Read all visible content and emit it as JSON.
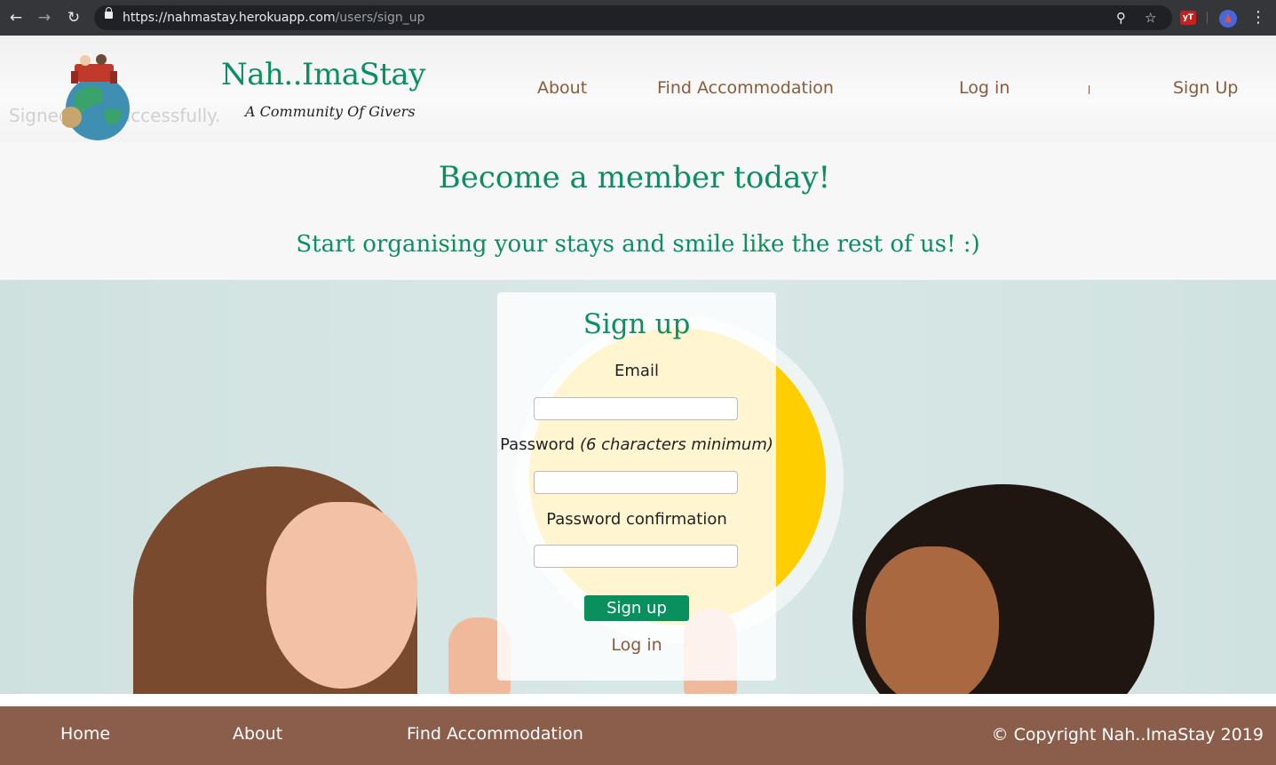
{
  "browser": {
    "url_host": "https://nahmastay.herokuapp.com",
    "url_path": "/users/sign_up",
    "icons": {
      "back": "back-arrow-icon",
      "forward": "forward-arrow-icon",
      "reload": "reload-icon",
      "zoom": "zoom-icon",
      "bookmark": "star-icon",
      "menu": "more-vertical-icon"
    },
    "extension_label": "yT"
  },
  "header": {
    "flash_message": "Signed out successfully.",
    "brand": "Nah..ImaStay",
    "tagline": "A Community Of Givers",
    "nav": {
      "about": "About",
      "find": "Find Accommodation",
      "login": "Log in",
      "signup": "Sign Up"
    }
  },
  "intro": {
    "title": "Become a member today!",
    "subtitle": "Start organising your stays and smile like the rest of us! :)"
  },
  "form": {
    "title": "Sign up",
    "email_label": "Email",
    "email_value": "",
    "password_label": "Password",
    "password_hint": "(6 characters minimum)",
    "password_value": "",
    "confirm_label": "Password confirmation",
    "confirm_value": "",
    "submit": "Sign up",
    "login_link": "Log in"
  },
  "footer": {
    "home": "Home",
    "about": "About",
    "find": "Find Accommodation",
    "copyright": "© Copyright Nah..ImaStay 2019"
  },
  "colors": {
    "brand_green": "#0a8f5e",
    "nav_brown": "#8a5a3c",
    "footer_bg": "#8b5e4b"
  }
}
